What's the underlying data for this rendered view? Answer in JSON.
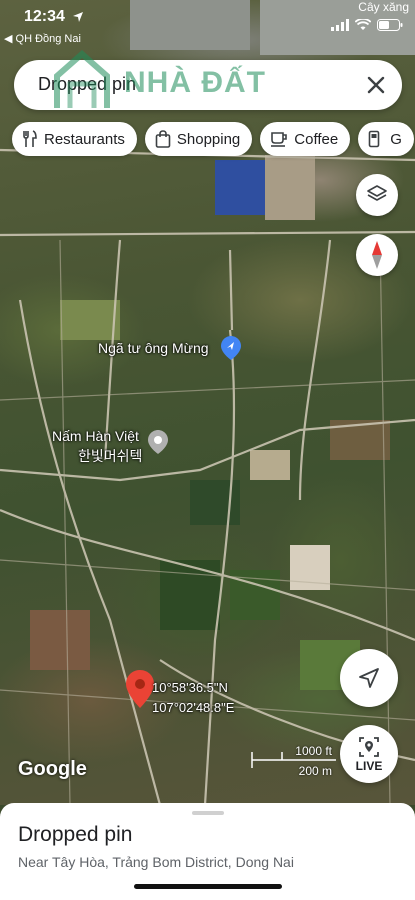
{
  "status_bar": {
    "time": "12:34",
    "back_label": "◀ QH Đồng Nai",
    "place_label": "Cây xăng"
  },
  "search": {
    "value": "Dropped pin",
    "watermark": "NHÀ ĐẤT"
  },
  "chips": [
    {
      "label": "Restaurants",
      "icon": "fork-knife-icon"
    },
    {
      "label": "Shopping",
      "icon": "shopping-bag-icon"
    },
    {
      "label": "Coffee",
      "icon": "coffee-cup-icon"
    },
    {
      "label": "G",
      "icon": "gas-station-icon"
    }
  ],
  "map": {
    "poi_1": "Ngã tư ông Mừng",
    "poi_2_line1": "Nấm Hàn Việt",
    "poi_2_line2": "한빛머쉬텍",
    "coord_lat": "10°58'36.5\"N",
    "coord_lng": "107°02'48.8\"E",
    "logo": "Google",
    "scale_ft": "1000 ft",
    "scale_m": "200 m",
    "live_label": "LIVE"
  },
  "sheet": {
    "title": "Dropped pin",
    "subtitle": "Near Tây Hòa, Trảng Bom District, Dong Nai"
  },
  "colors": {
    "pin_red": "#ea4335",
    "poi_blue": "#4285f4",
    "compass_red": "#e53935"
  }
}
